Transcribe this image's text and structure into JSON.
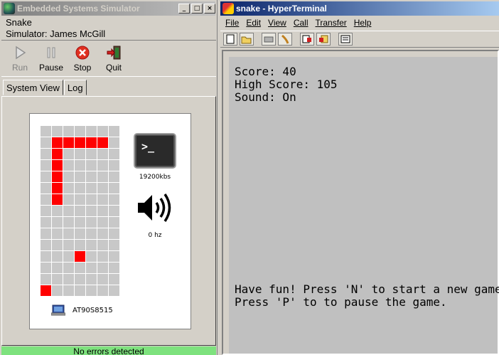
{
  "simulator": {
    "window_title": "Embedded Systems Simulator",
    "program": "Snake",
    "author_line": "Simulator: James McGill",
    "toolbar": {
      "run_label": "Run",
      "pause_label": "Pause",
      "stop_label": "Stop",
      "quit_label": "Quit"
    },
    "tabs": [
      {
        "label": "System View"
      },
      {
        "label": "Log"
      }
    ],
    "board": {
      "grid_cols": 7,
      "grid_rows": 15,
      "lit_cells": [
        [
          2,
          2
        ],
        [
          2,
          3
        ],
        [
          2,
          4
        ],
        [
          2,
          5
        ],
        [
          2,
          6
        ],
        [
          3,
          2
        ],
        [
          4,
          2
        ],
        [
          5,
          2
        ],
        [
          6,
          2
        ],
        [
          7,
          2
        ],
        [
          12,
          4
        ],
        [
          15,
          1
        ]
      ],
      "serial_speed": "19200kbs",
      "sound_freq": "0 hz",
      "mcu": "AT90S8515"
    },
    "status": "No errors detected",
    "colors": {
      "lit": "#ff0000",
      "unlit": "#c8c8c8",
      "status": "#7ee27e"
    }
  },
  "hyperterminal": {
    "window_title": "snake - HyperTerminal",
    "menu": [
      "File",
      "Edit",
      "View",
      "Call",
      "Transfer",
      "Help"
    ],
    "toolbar_icons": [
      "new-icon",
      "open-icon",
      "disconnect-icon",
      "dial-icon",
      "send-icon",
      "receive-icon",
      "properties-icon"
    ],
    "terminal_lines_top": [
      "Score: 40",
      "High Score: 105",
      "Sound: On"
    ],
    "terminal_lines_bottom": [
      "Have fun! Press 'N' to start a new game",
      "Press 'P' to to pause the game."
    ]
  }
}
